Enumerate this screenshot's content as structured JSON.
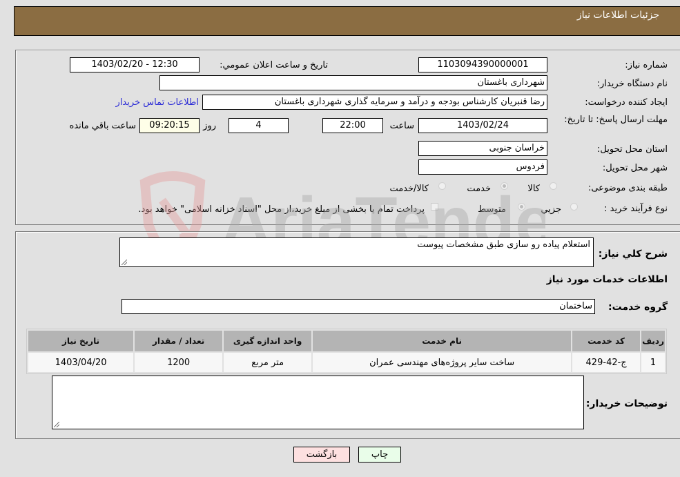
{
  "header": {
    "title": "جزئیات اطلاعات نیاز"
  },
  "form": {
    "need_number": {
      "label": "شماره نیاز:",
      "value": "1103094390000001"
    },
    "announce_datetime": {
      "label": "تاریخ و ساعت اعلان عمومي:",
      "value": "1403/02/20 - 12:30"
    },
    "buyer_org": {
      "label": "نام دستگاه خریدار:",
      "value": "شهرداری باغستان"
    },
    "requester": {
      "label": "ایجاد کننده درخواست:",
      "value": "رضا قنبریان کارشناس بودجه و درآمد و سرمایه گذاری شهرداری باغستان",
      "contact_link": "اطلاعات تماس خریدار"
    },
    "deadline": {
      "label": "مهلت ارسال پاسخ: تا تاریخ:",
      "date": "1403/02/24",
      "time_label": "ساعت",
      "time": "22:00",
      "days": "4",
      "days_label": "روز و",
      "remaining": "09:20:15",
      "remaining_label": "ساعت باقي مانده"
    },
    "province": {
      "label": "استان محل تحویل:",
      "value": "خراسان جنوبی"
    },
    "city": {
      "label": "شهر محل تحویل:",
      "value": "فردوس"
    },
    "category": {
      "label": "طبقه بندی موضوعی:",
      "options": [
        "کالا",
        "خدمت",
        "کالا/خدمت"
      ],
      "selected": "خدمت"
    },
    "purchase_type": {
      "label": "نوع فرآیند خرید :",
      "options": [
        "جزيي",
        "متوسط"
      ],
      "selected": "متوسط",
      "treasury_note": "پرداخت تمام یا بخشی از مبلغ خرید،از محل \"اسناد خزانه اسلامی\" خواهد بود."
    }
  },
  "details": {
    "general_desc_label": "شرح کلي نیاز:",
    "general_desc": "استعلام پیاده رو سازی طبق مشخصات پیوست",
    "services_heading": "اطلاعات خدمات مورد نیاز",
    "service_group_label": "گروه خدمت:",
    "service_group": "ساختمان",
    "table": {
      "headers": [
        "ردیف",
        "کد خدمت",
        "نام خدمت",
        "واحد اندازه گیری",
        "تعداد / مقدار",
        "تاریخ نیاز"
      ],
      "rows": [
        [
          "1",
          "ج-42-429",
          "ساخت سایر پروژه‌های مهندسی عمران",
          "متر مربع",
          "1200",
          "1403/04/20"
        ]
      ]
    },
    "buyer_notes_label": "توضیحات خریدار:",
    "buyer_notes": ""
  },
  "buttons": {
    "back": "بازگشت",
    "print": "چاپ"
  },
  "watermark": {
    "text": "AriaTender.neT"
  },
  "colors": {
    "header_bg": "#8b6d42",
    "link": "#2b2bd6",
    "back_btn": "#fde0e0",
    "print_btn": "#e9fde9"
  }
}
